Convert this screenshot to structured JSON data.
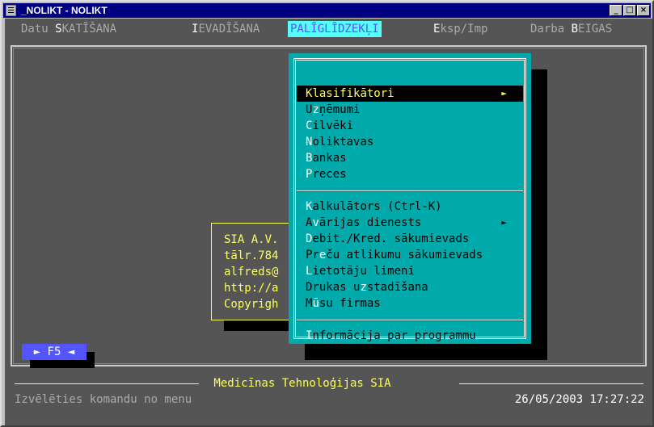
{
  "window": {
    "title": "_NOLIKT - NOLIKT",
    "minimize": "_",
    "maximize": "□",
    "close": "×"
  },
  "menubar": [
    {
      "hotkey": "",
      "pre": "Datu ",
      "hk": "S",
      "post": "KATĪŠANA"
    },
    {
      "pre": "",
      "hk": "I",
      "post": "EVADĪŠANA"
    },
    {
      "pre": "PALĪGLĪDZEKĻI",
      "hk": "",
      "post": ""
    },
    {
      "pre": "",
      "hk": "E",
      "post": "ksp/Imp"
    },
    {
      "pre": "Darba ",
      "hk": "B",
      "post": "EIGAS"
    }
  ],
  "dropdown": {
    "items": [
      {
        "hk": "K",
        "rest": "lasifikātori",
        "arrow": "►"
      },
      {
        "pre": "U",
        "hk": "z",
        "rest": "ņēmumi"
      },
      {
        "hk": "C",
        "rest": "ilvēki"
      },
      {
        "hk": "N",
        "rest": "oliktavas"
      },
      {
        "hk": "B",
        "rest": "ankas"
      },
      {
        "hk": "P",
        "rest": "reces"
      },
      {
        "hk": "K",
        "rest": "alkulātors (Ctrl-K)"
      },
      {
        "pre": "A",
        "hk": "v",
        "rest": "ārijas dienests",
        "arrow": "►"
      },
      {
        "hk": "D",
        "rest": "ebit./Kred. sākumievads"
      },
      {
        "pre": "Pr",
        "hk": "e",
        "rest": "ču atlikumu sākumievads"
      },
      {
        "hk": "L",
        "rest": "ietotāju limeni"
      },
      {
        "pre": "Drukas u",
        "hk": "z",
        "rest": "stadīšana"
      },
      {
        "pre": "M",
        "hk": "ū",
        "rest": "su firmas"
      },
      {
        "hk": "I",
        "rest": "nformācija par programmu"
      }
    ]
  },
  "infobox": {
    "lines": [
      "SIA A.V.",
      "tālr.784",
      "alfreds@",
      "http://a",
      "Copyrigh"
    ]
  },
  "f5": "► F5 ◄",
  "status": {
    "company": " Medicīnas Tehnoloģijas SIA ",
    "hint": "Izvēlēties komandu no menu",
    "datetime": "26/05/2003 17:27:22"
  },
  "colors": {
    "background": "#555555",
    "menu_active": "#55ffff",
    "dropdown": "#00aaaa",
    "highlight": "#ffff55",
    "f5_button": "#5555ff"
  }
}
